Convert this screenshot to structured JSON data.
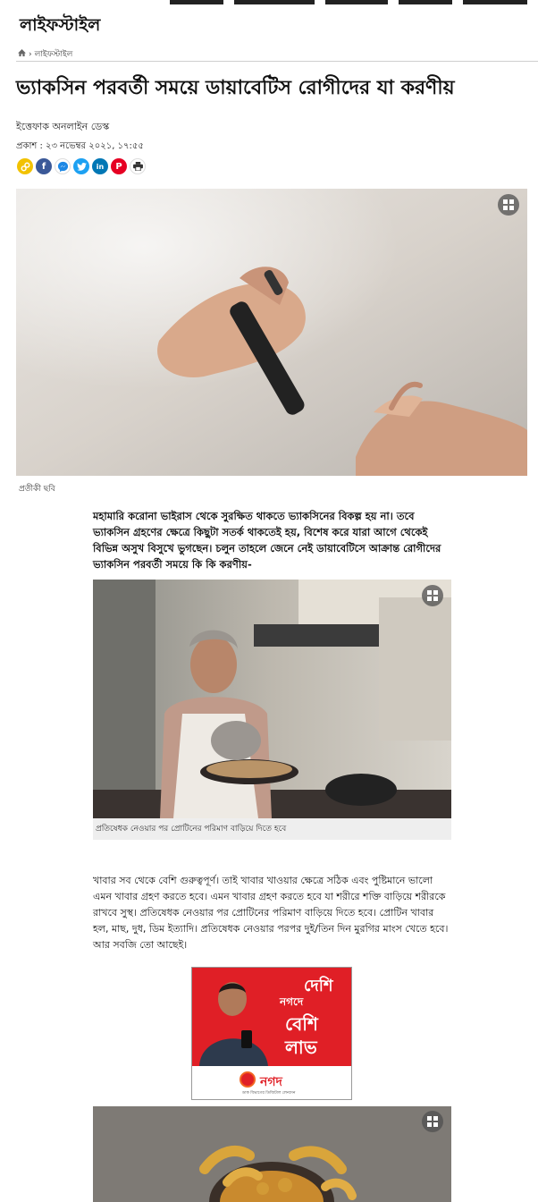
{
  "section": {
    "title": "লাইফস্টাইল"
  },
  "breadcrumb": {
    "home_icon": "home-icon",
    "separator": "›",
    "current": "লাইফস্টাইল"
  },
  "article": {
    "headline": "ভ্যাকসিন পরবর্তী সময়ে ডায়াবেটিস রোগীদের যা করণীয়",
    "author": "ইত্তেফাক অনলাইন ডেস্ক",
    "published": "প্রকাশ : ২৩ নভেম্বর ২০২১, ১৭:৫৫",
    "hero_caption": "প্রতীকী ছবি",
    "lead": "মহামারি করোনা ভাইরাস থেকে সুরক্ষিত থাকতে ভ্যাকসিনের বিকল্প হয় না। তবে ভ্যাকসিন গ্রহণের ক্ষেত্রে কিছুটা সতর্ক থাকতেই হয়, বিশেষ করে যারা আগে থেকেই বিভিন্ন অসুখ বিসুখে ভুগছেন। চলুন তাহলে জেনে নেই ডায়াবেটিসে আক্রান্ত রোগীদের ভ্যাকসিন পরবর্তী সময়ে কি কি করণীয়-",
    "image2_caption": "প্রতিষেধক নেওয়ার পর প্রোটিনের পরিমাণ বাড়িয়ে দিতে হবে",
    "body_paragraph": "খাবার সব থেকে বেশি গুরুত্বপূর্ণ। তাই খাবার খাওয়ার ক্ষেত্রে সঠিক এবং পুষ্টিমানে ভালো এমন খাবার গ্রহণ করতে হবে। এমন খাবার গ্রহণ করতে হবে যা শরীরে শক্তি বাড়িয়ে শরীরকে রাখবে সুস্থ। প্রতিষেধক নেওয়ার পর প্রোটিনের পরিমাণ বাড়িয়ে দিতে হবে। প্রোটিন খাবার হল, মাছ, দুধ, ডিম ইত্যাদি। প্রতিষেধক নেওয়ার পরপর দুই/তিন দিন মুরগির মাংস খেতে হবে। আর সবজি তো আছেই।"
  },
  "share_icons": [
    {
      "name": "copy-link-icon",
      "color": "#f2c200",
      "glyph": "∞"
    },
    {
      "name": "facebook-icon",
      "color": "#3b5998",
      "glyph": "f"
    },
    {
      "name": "messenger-icon",
      "color": "#ffffff",
      "glyph": ""
    },
    {
      "name": "twitter-icon",
      "color": "#1da1f2",
      "glyph": "t"
    },
    {
      "name": "linkedin-icon",
      "color": "#0077b5",
      "glyph": "in"
    },
    {
      "name": "pinterest-icon",
      "color": "#e60023",
      "glyph": "P"
    },
    {
      "name": "print-icon",
      "color": "#ffffff",
      "glyph": ""
    }
  ],
  "ad": {
    "brand": "নগদ",
    "headline_line1": "দেশি",
    "headline_line2": "নগদে",
    "headline_line3": "বেশি লাভ",
    "tagline": "ডাক বিভাগের ডিজিটাল লেনদেন",
    "colors": {
      "red": "#e01f26",
      "orange": "#f26522"
    }
  }
}
